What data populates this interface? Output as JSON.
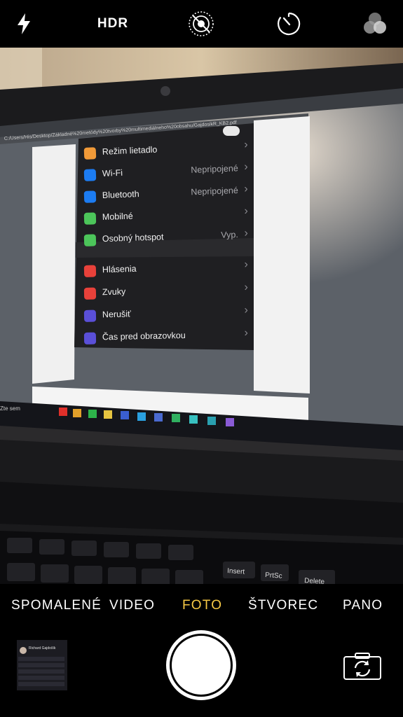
{
  "topbar": {
    "flash_icon": "flash-bolt-icon",
    "hdr_label": "HDR",
    "live_photo_icon": "live-photo-off-icon",
    "timer_icon": "timer-icon",
    "filters_icon": "filters-icon"
  },
  "screen": {
    "file_path": "C:/Users/His/Desktop/Základné%20metódy%20tvorby%20multimediálneho%20obsahu/GajdosikR_KB2.pdf",
    "settings_rows_group1": [
      {
        "label": "Režim lietadlo",
        "value": "",
        "icon_color": "#f19a38",
        "icon": "airplane-icon"
      },
      {
        "label": "Wi-Fi",
        "value": "Nepripojené",
        "icon_color": "#1c7cf2",
        "icon": "wifi-icon"
      },
      {
        "label": "Bluetooth",
        "value": "Nepripojené",
        "icon_color": "#1c7cf2",
        "icon": "bluetooth-icon"
      },
      {
        "label": "Mobilné",
        "value": "",
        "icon_color": "#4cc55a",
        "icon": "antenna-icon"
      },
      {
        "label": "Osobný hotspot",
        "value": "Vyp.",
        "icon_color": "#4cc55a",
        "icon": "hotspot-icon"
      }
    ],
    "settings_rows_group2": [
      {
        "label": "Hlásenia",
        "value": "",
        "icon_color": "#e8413a",
        "icon": "notifications-icon"
      },
      {
        "label": "Zvuky",
        "value": "",
        "icon_color": "#e8413a",
        "icon": "sound-icon"
      },
      {
        "label": "Nerušiť",
        "value": "",
        "icon_color": "#5a4fd8",
        "icon": "moon-icon"
      },
      {
        "label": "Čas pred obrazovkou",
        "value": "",
        "icon_color": "#5a4fd8",
        "icon": "hourglass-icon"
      }
    ],
    "taskbar_search_text": "Zte sem",
    "keyboard_keys": [
      "Insert",
      "PrtSc",
      "Delete"
    ]
  },
  "modes": {
    "items": [
      "SPOMALENÉ",
      "VIDEO",
      "FOTO",
      "ŠTVOREC",
      "PANO"
    ],
    "active": "FOTO",
    "active_color": "#f7c945"
  },
  "bottom": {
    "thumbnail_name": "Richard Gajdošík",
    "shutter_icon": "shutter-button",
    "flip_icon": "camera-flip-icon"
  }
}
